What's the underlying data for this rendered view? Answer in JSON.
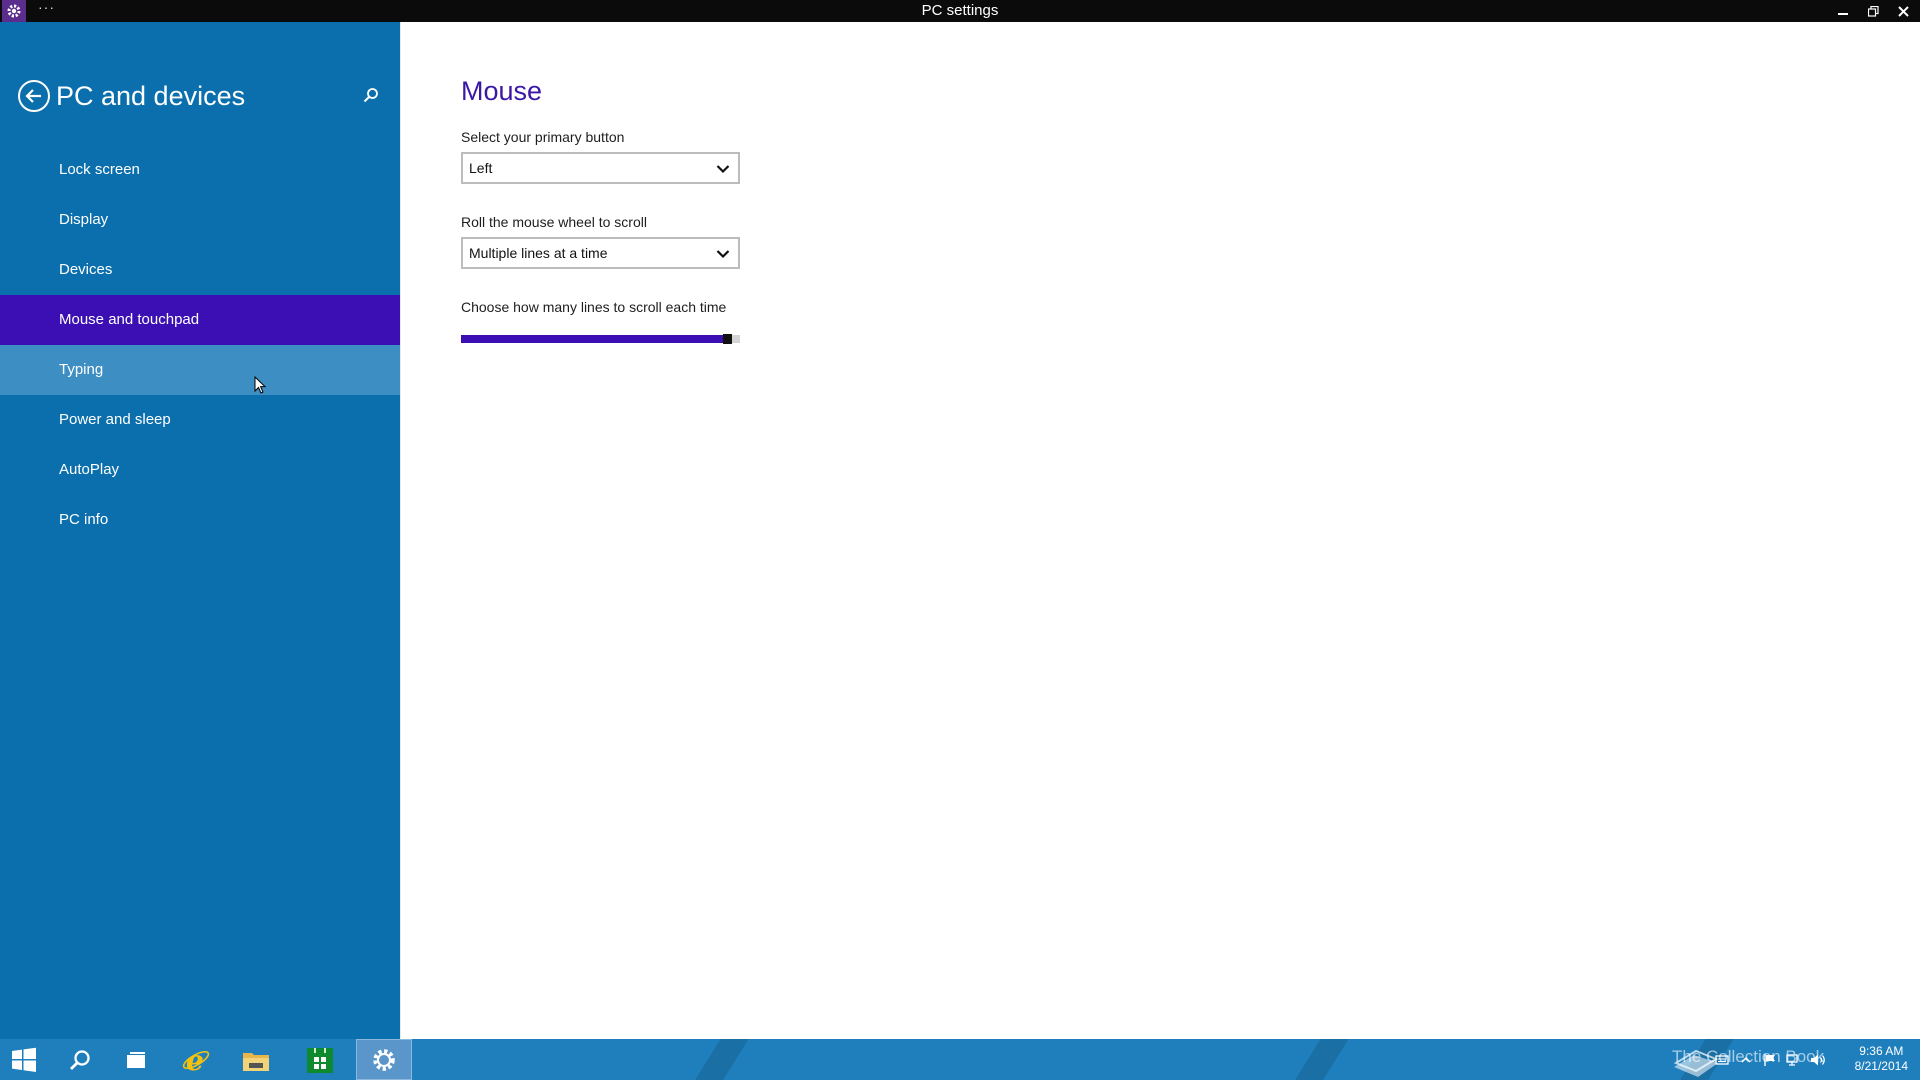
{
  "window": {
    "title": "PC settings",
    "menu_dots": "···",
    "controls": [
      "minimize-icon",
      "restore-icon",
      "close-icon"
    ]
  },
  "sidebar": {
    "title": "PC and devices",
    "back_icon": "back-arrow-icon",
    "search_icon": "search-icon",
    "items": [
      {
        "label": "Lock screen",
        "state": "normal"
      },
      {
        "label": "Display",
        "state": "normal"
      },
      {
        "label": "Devices",
        "state": "normal"
      },
      {
        "label": "Mouse and touchpad",
        "state": "selected"
      },
      {
        "label": "Typing",
        "state": "hover"
      },
      {
        "label": "Power and sleep",
        "state": "normal"
      },
      {
        "label": "AutoPlay",
        "state": "normal"
      },
      {
        "label": "PC info",
        "state": "normal"
      }
    ]
  },
  "main": {
    "section_title": "Mouse",
    "primary_button": {
      "label": "Select your primary button",
      "value": "Left"
    },
    "wheel_scroll": {
      "label": "Roll the mouse wheel to scroll",
      "value": "Multiple lines at a time"
    },
    "lines_slider": {
      "label": "Choose how many lines to scroll each time",
      "fraction": 0.97
    }
  },
  "taskbar": {
    "buttons": [
      "start-icon",
      "search-icon",
      "task-view-icon",
      "internet-explorer-icon",
      "file-explorer-icon",
      "store-icon",
      "settings-icon"
    ],
    "active_button": "settings-icon",
    "tray_icons": [
      "keyboard-icon",
      "chevron-up-icon",
      "flag-icon",
      "network-icon",
      "volume-icon"
    ],
    "watermark": "The Collection Book",
    "time": "9:36 AM",
    "date": "8/21/2014"
  },
  "colors": {
    "sidebar_bg": "#0a6fac",
    "selected_item": "#3b0fb4",
    "hover_item": "#3d8ec3",
    "accent_title": "#3b17a6",
    "taskbar_bg": "#1f7fbd"
  }
}
